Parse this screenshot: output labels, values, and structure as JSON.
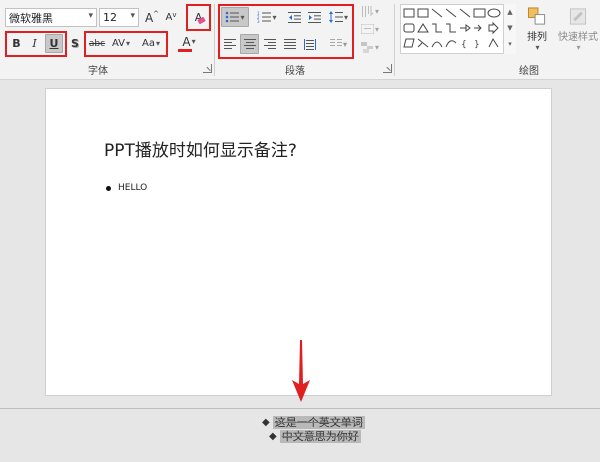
{
  "font_group": {
    "font_name": "微软雅黑",
    "font_size": "12",
    "grow_label": "A",
    "shrink_label": "A",
    "clear_format_label": "A",
    "bold_label": "B",
    "italic_label": "I",
    "underline_label": "U",
    "shadow_label": "S",
    "strikethrough_label": "abc",
    "spacing_label": "AV",
    "case_label": "Aa",
    "font_color_label": "A",
    "label": "字体"
  },
  "paragraph_group": {
    "label": "段落"
  },
  "drawing_group": {
    "arrange_label": "排列",
    "quick_styles_label": "快速样式",
    "label": "绘图"
  },
  "slide": {
    "title": "PPT播放时如何显示备注?",
    "bullet": "HELLO"
  },
  "notes": {
    "lines": [
      "这是一个英文单词",
      "中文意思为你好"
    ]
  },
  "colors": {
    "accent_red": "#e02020",
    "font_color_underline": "#e02020",
    "slide_bg": "#ffffff",
    "ribbon_bg": "#f3f3f3"
  }
}
